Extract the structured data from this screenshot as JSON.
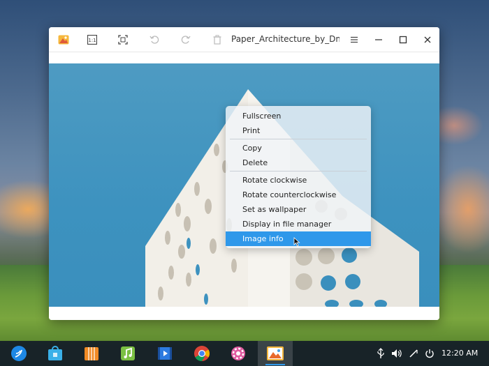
{
  "window": {
    "title": "Paper_Architecture_by_Dmitri_I",
    "toolbar": {
      "icons": [
        "image-viewer-app-icon",
        "actual-size-icon",
        "fit-window-icon",
        "rotate-ccw-icon",
        "rotate-cw-icon",
        "delete-icon"
      ],
      "window_controls": [
        "menu-icon",
        "minimize-icon",
        "maximize-icon",
        "close-icon"
      ]
    }
  },
  "context_menu": {
    "items": [
      {
        "label": "Fullscreen"
      },
      {
        "label": "Print"
      },
      {
        "label": "Copy"
      },
      {
        "label": "Delete"
      },
      {
        "label": "Rotate clockwise"
      },
      {
        "label": "Rotate counterclockwise"
      },
      {
        "label": "Set as wallpaper"
      },
      {
        "label": "Display in file manager"
      },
      {
        "label": "Image info",
        "highlighted": true
      }
    ]
  },
  "taskbar": {
    "apps": [
      "launcher-icon",
      "app-store-icon",
      "archive-icon",
      "music-icon",
      "video-icon",
      "chrome-icon",
      "settings-icon",
      "image-viewer-icon"
    ],
    "active_app": "image-viewer-icon",
    "tray": [
      "usb-icon",
      "volume-icon",
      "wifi-icon",
      "power-icon"
    ],
    "clock": "12:20 AM"
  },
  "colors": {
    "accent": "#2f98ea",
    "taskbar_bg": "#141c28",
    "image_sky": "#3d92bf"
  }
}
